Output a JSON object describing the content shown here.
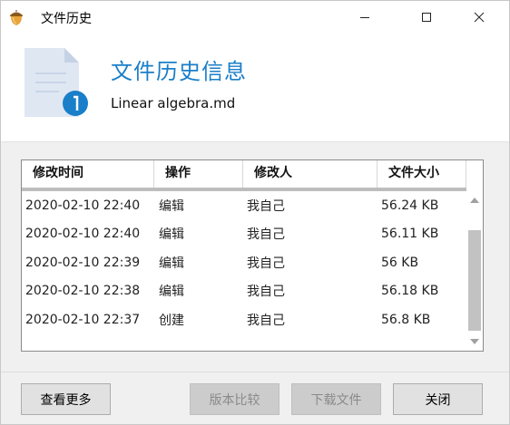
{
  "window": {
    "title": "文件历史",
    "icon": "acorn-icon"
  },
  "header": {
    "title": "文件历史信息",
    "file_name": "Linear algebra.md"
  },
  "table": {
    "columns": [
      "修改时间",
      "操作",
      "修改人",
      "文件大小"
    ],
    "rows": [
      {
        "time": "2020-02-10 22:40",
        "op": "编辑",
        "user": "我自己",
        "size": "56.24 KB"
      },
      {
        "time": "2020-02-10 22:40",
        "op": "编辑",
        "user": "我自己",
        "size": "56.11 KB"
      },
      {
        "time": "2020-02-10 22:39",
        "op": "编辑",
        "user": "我自己",
        "size": "56 KB"
      },
      {
        "time": "2020-02-10 22:38",
        "op": "编辑",
        "user": "我自己",
        "size": "56.18 KB"
      },
      {
        "time": "2020-02-10 22:37",
        "op": "创建",
        "user": "我自己",
        "size": "56.8 KB"
      }
    ]
  },
  "footer": {
    "more_label": "查看更多",
    "compare_label": "版本比较",
    "download_label": "下载文件",
    "close_label": "关闭"
  },
  "colors": {
    "accent": "#1a7fc9",
    "panel": "#f0f0f0"
  }
}
